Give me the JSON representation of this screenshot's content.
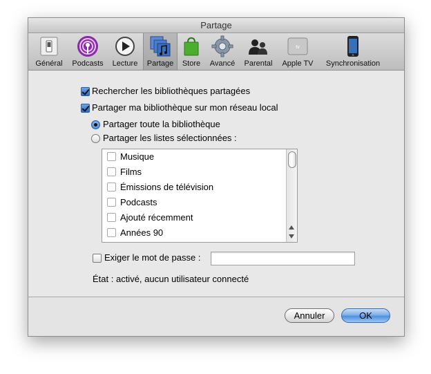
{
  "window": {
    "title": "Partage"
  },
  "toolbar": {
    "items": [
      {
        "label": "Général",
        "icon": "switch-icon"
      },
      {
        "label": "Podcasts",
        "icon": "podcast-icon"
      },
      {
        "label": "Lecture",
        "icon": "play-icon"
      },
      {
        "label": "Partage",
        "icon": "sharing-icon",
        "selected": true
      },
      {
        "label": "Store",
        "icon": "shopping-bag-icon"
      },
      {
        "label": "Avancé",
        "icon": "gear-icon"
      },
      {
        "label": "Parental",
        "icon": "parental-icon"
      },
      {
        "label": "Apple TV",
        "icon": "apple-tv-icon"
      },
      {
        "label": "Synchronisation",
        "icon": "iphone-icon"
      }
    ]
  },
  "sharing": {
    "search_shared_label": "Rechercher les bibliothèques partagées",
    "search_shared_checked": true,
    "share_library_label": "Partager ma bibliothèque sur mon réseau local",
    "share_library_checked": true,
    "share_all_label": "Partager toute la bibliothèque",
    "share_selected_label": "Partager les listes sélectionnées :",
    "share_mode": "all",
    "playlists": [
      {
        "label": "Musique",
        "checked": false
      },
      {
        "label": "Films",
        "checked": false
      },
      {
        "label": "Émissions de télévision",
        "checked": false
      },
      {
        "label": "Podcasts",
        "checked": false
      },
      {
        "label": "Ajouté récemment",
        "checked": false
      },
      {
        "label": "Années 90",
        "checked": false
      }
    ],
    "require_password_label": "Exiger le mot de passe :",
    "require_password_checked": false,
    "password_value": "",
    "status_text": "État : activé, aucun utilisateur connecté"
  },
  "buttons": {
    "cancel_label": "Annuler",
    "ok_label": "OK"
  },
  "colors": {
    "accent": "#3a7dd1",
    "window_bg": "#e8e8e8"
  }
}
